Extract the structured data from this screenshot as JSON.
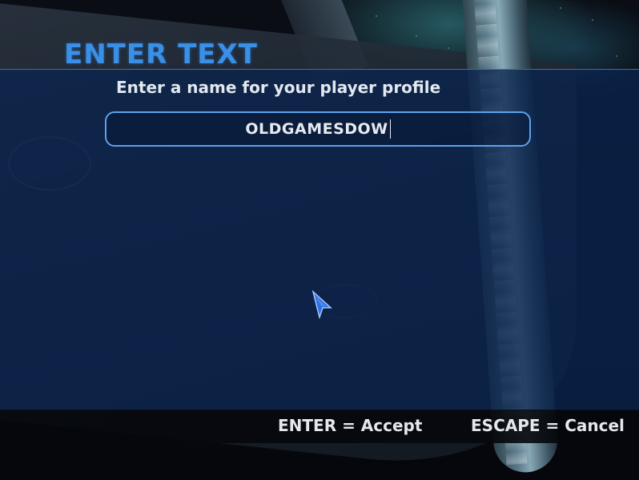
{
  "dialog": {
    "title": "ENTER TEXT",
    "prompt": "Enter a name for your player profile",
    "input_value": "OLDGAMESDOW"
  },
  "footer": {
    "accept_hint": "ENTER = Accept",
    "cancel_hint": "ESCAPE = Cancel"
  },
  "colors": {
    "title": "#3a8fe6",
    "panel": "#0a244e",
    "input_border": "#5aa2ee",
    "text": "#e2e8f0"
  },
  "icons": {
    "pointer": "arrow-cursor-icon"
  }
}
